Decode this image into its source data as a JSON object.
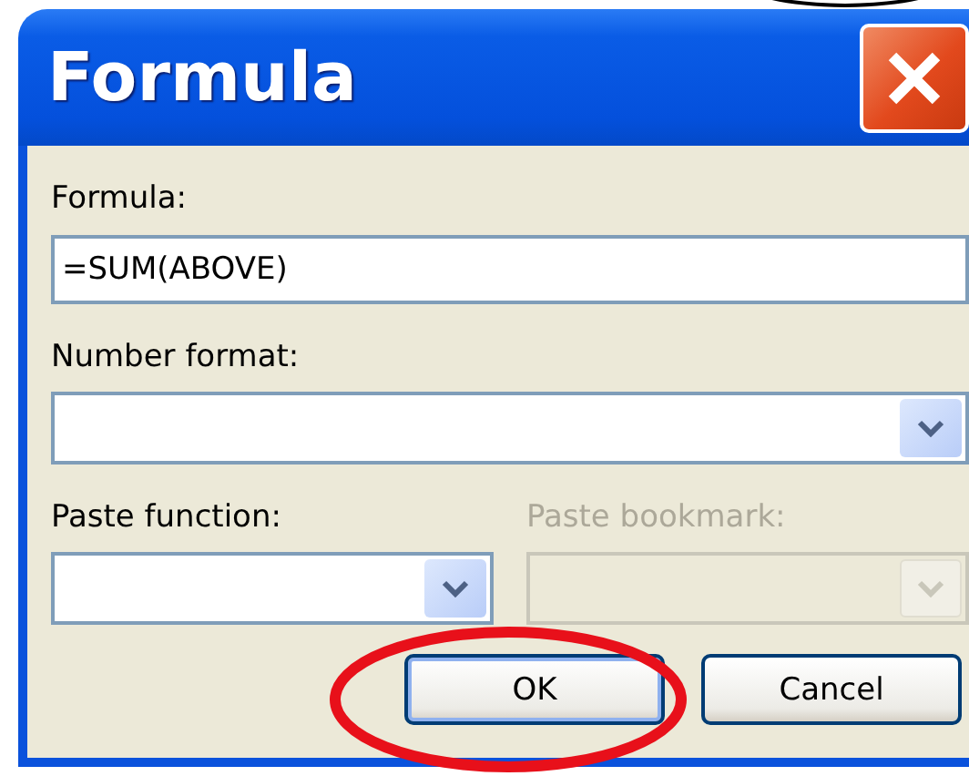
{
  "window": {
    "title": "Formula"
  },
  "fields": [
    {
      "kind": "text",
      "label": "Formula:",
      "value": "=SUM(ABOVE)",
      "disabled": false
    },
    {
      "kind": "dropdown",
      "label": "Number format:",
      "disabled": false
    }
  ],
  "dropdowns": [
    {
      "label": "Paste function:",
      "disabled": false
    },
    {
      "label": "Paste bookmark:",
      "disabled": true
    }
  ],
  "buttons": [
    {
      "label": "OK",
      "default": true,
      "circled": true
    },
    {
      "label": "Cancel",
      "default": false,
      "circled": false
    }
  ]
}
